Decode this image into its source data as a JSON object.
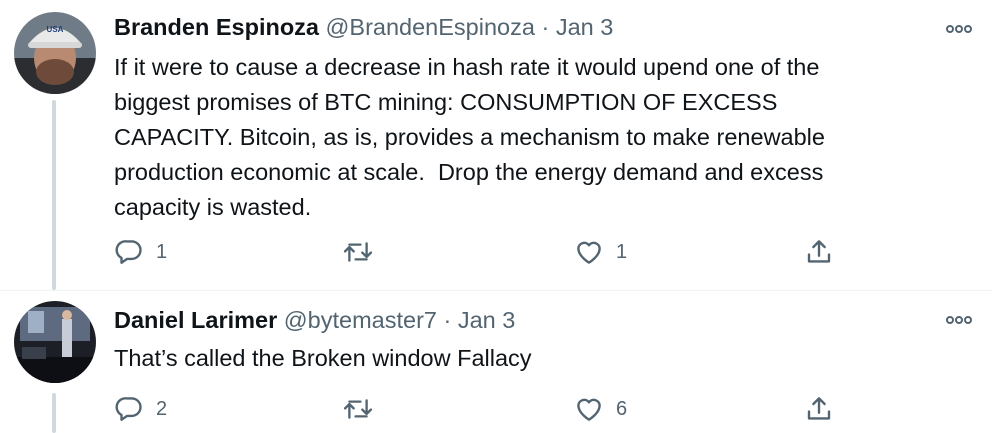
{
  "tweets": [
    {
      "author_name": "Branden Espinoza",
      "handle": "@BrandenEspinoza",
      "separator": "·",
      "date": "Jan 3",
      "avatar_cap_text": "USA",
      "text": "If it were to cause a decrease in hash rate it would upend one of the\nbiggest promises of BTC mining: CONSUMPTION OF EXCESS\nCAPACITY. Bitcoin, as is, provides a mechanism to make renewable\nproduction economic at scale.  Drop the energy demand and excess\ncapacity is wasted.",
      "reply_count": "1",
      "retweet_count": "",
      "like_count": "1"
    },
    {
      "author_name": "Daniel Larimer",
      "handle": "@bytemaster7",
      "separator": "·",
      "date": "Jan 3",
      "text": "That’s called the Broken window Fallacy",
      "reply_count": "2",
      "retweet_count": "",
      "like_count": "6"
    }
  ],
  "icons": {
    "more": "more-icon",
    "reply": "reply-icon",
    "retweet": "retweet-icon",
    "like": "like-icon",
    "share": "share-icon"
  },
  "colors": {
    "text": "#0f1419",
    "secondary": "#536471",
    "thread_line": "#cfd9de"
  }
}
